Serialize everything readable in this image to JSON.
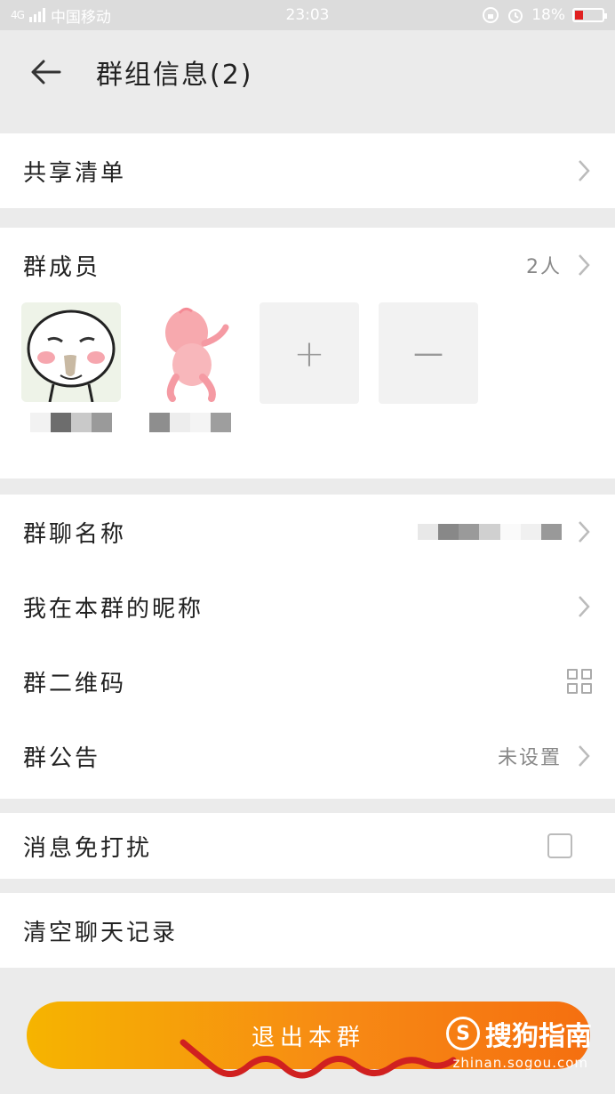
{
  "status_bar": {
    "network_type": "4G",
    "carrier": "中国移动",
    "time": "23:03",
    "battery_percent": "18%",
    "icons": [
      "signal-icon",
      "lock-rotation-icon",
      "alarm-icon",
      "battery-icon"
    ]
  },
  "header": {
    "title": "群组信息(2)",
    "back_icon": "arrow-left-icon"
  },
  "shared_list": {
    "label": "共享清单"
  },
  "members": {
    "label": "群成员",
    "count": "2人",
    "items": [
      {
        "avatar": "meme-face-avatar"
      },
      {
        "avatar": "pink-peach-avatar"
      }
    ],
    "add_symbol": "+",
    "remove_symbol": "—"
  },
  "settings": {
    "group_name_label": "群聊名称",
    "my_nickname_label": "我在本群的昵称",
    "qr_code_label": "群二维码",
    "announcement_label": "群公告",
    "announcement_value": "未设置"
  },
  "notifications": {
    "dnd_label": "消息免打扰",
    "dnd_checked": false
  },
  "clear_history": {
    "label": "清空聊天记录"
  },
  "exit_button": {
    "label": "退出本群"
  },
  "watermark": {
    "logo_letter": "S",
    "brand": "搜狗指南",
    "url": "zhinan.sogou.com"
  },
  "colors": {
    "accent_start": "#f6b400",
    "accent_end": "#f56f10",
    "battery_low": "#e02020"
  }
}
